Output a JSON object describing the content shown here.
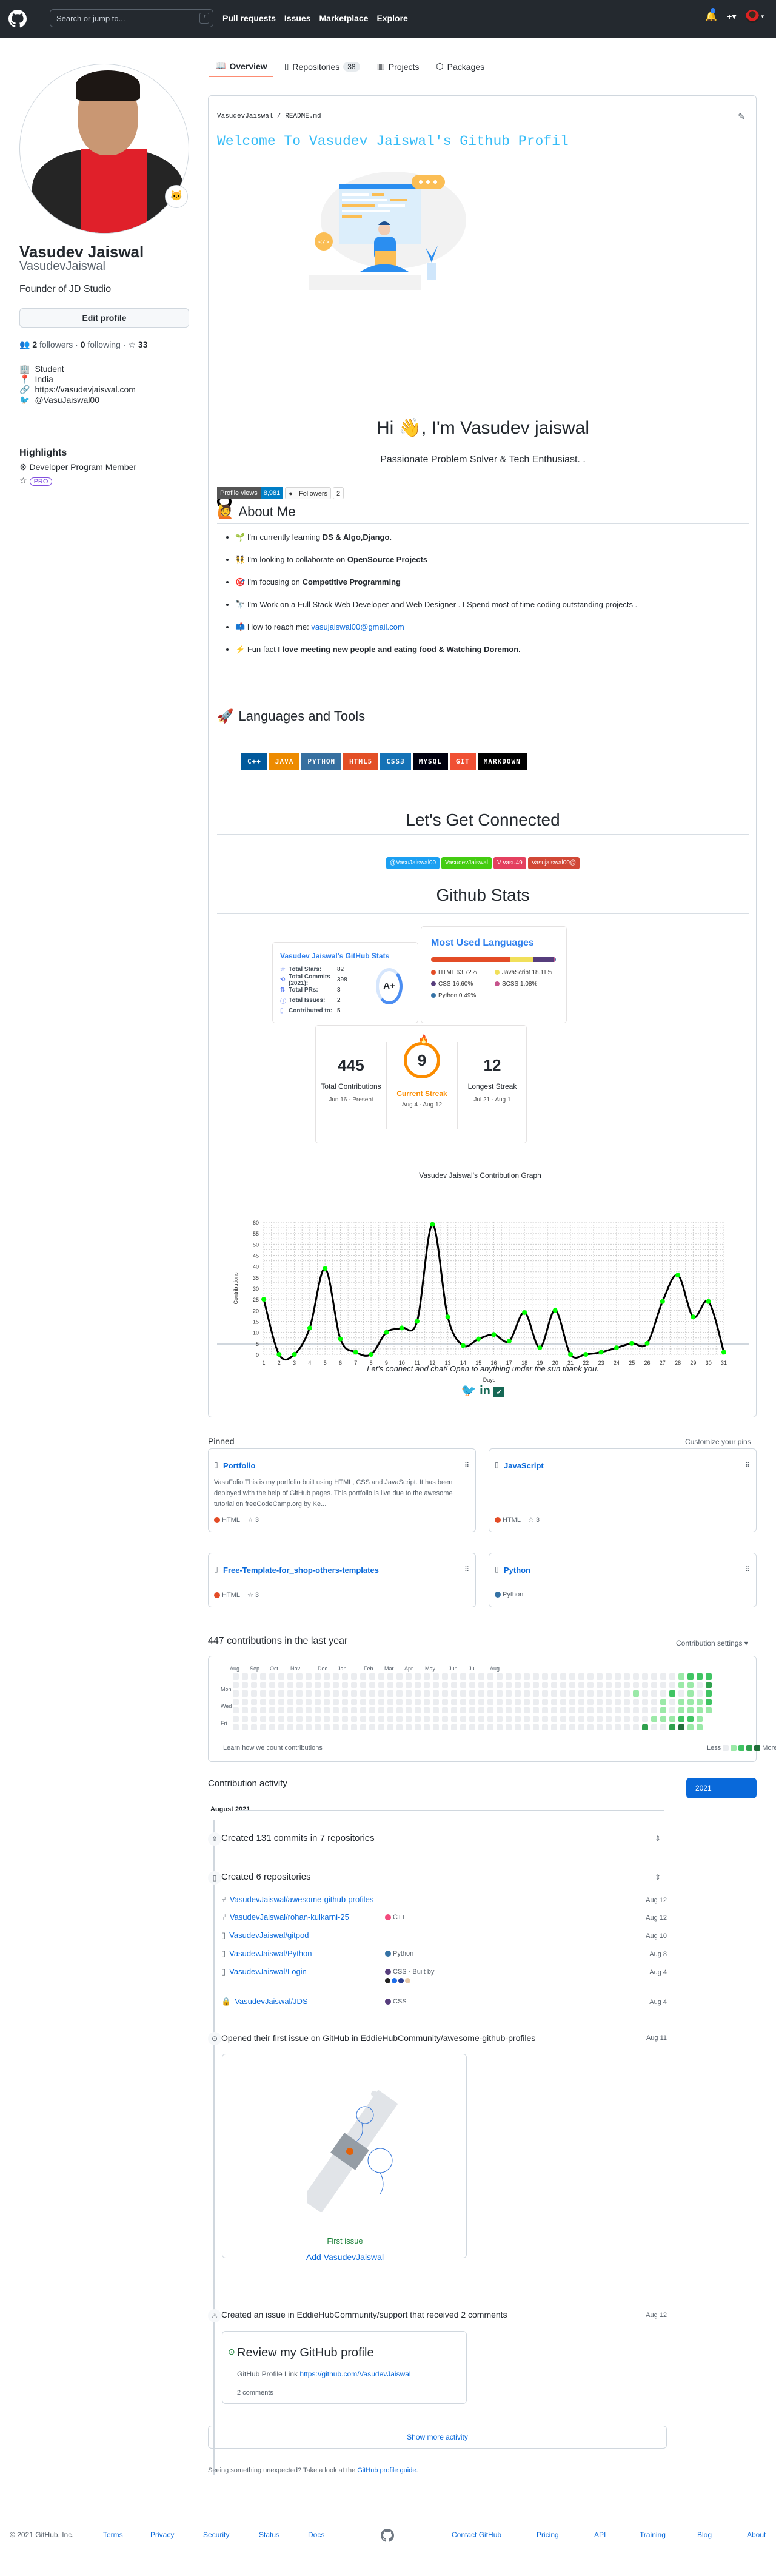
{
  "header": {
    "search_placeholder": "Search or jump to...",
    "search_shortcut": "/",
    "nav": [
      "Pull requests",
      "Issues",
      "Marketplace",
      "Explore"
    ],
    "plus_label": "+▾",
    "avatar_caret": "▾"
  },
  "tabs": [
    {
      "label": "Overview",
      "icon": "book-icon",
      "active": true
    },
    {
      "label": "Repositories",
      "icon": "repo-icon",
      "count": "38"
    },
    {
      "label": "Projects",
      "icon": "project-icon"
    },
    {
      "label": "Packages",
      "icon": "package-icon"
    }
  ],
  "profile": {
    "fullname": "Vasudev Jaiswal",
    "login": "VasudevJaiswal",
    "bio": "Founder of JD Studio",
    "edit_button": "Edit profile",
    "followers": "2",
    "followers_label": "followers",
    "following": "0",
    "following_label": "following",
    "stars": "33",
    "company": "Student",
    "location": "India",
    "website": "https://vasudevjaiswal.com",
    "twitter": "@VasuJaiswal00",
    "highlights_title": "Highlights",
    "highlight_program": "Developer Program Member",
    "pro_badge": "PRO"
  },
  "readme": {
    "path": "VasudevJaiswal / README.md",
    "typing_text": "Welcome To Vasudev Jaiswal's Github Profil",
    "greeting": "Hi 👋, I'm Vasudev jaiswal",
    "tagline": "Passionate Problem Solver & Tech Enthusiast. .",
    "badge_views_label": "Profile views",
    "badge_views_value": "8,981",
    "badge_followers_label": "Followers",
    "badge_followers_value": "2",
    "about_title": "About Me",
    "about_items": [
      {
        "emoji": "🌱",
        "text": "I'm currently learning ",
        "bold": "DS & Algo,Django."
      },
      {
        "emoji": "👯",
        "text": "I'm looking to collaborate on ",
        "bold": "OpenSource Projects"
      },
      {
        "emoji": "🎯",
        "text": "I'm focusing on ",
        "bold": "Competitive Programming"
      },
      {
        "emoji": "🔭",
        "text": "I'm Work on a Full Stack Web Developer and Web Designer . I Spend most of time coding outstanding projects .",
        "bold": ""
      },
      {
        "emoji": "📫",
        "text": "How to reach me: ",
        "link": "vasujaiswal00@gmail.com"
      },
      {
        "emoji": "⚡",
        "text": "Fun fact ",
        "bold": "I love meeting new people and eating food & Watching Doremon."
      }
    ],
    "tools_title": "Languages and Tools",
    "tools": [
      {
        "label": "C++",
        "color": "#00599c"
      },
      {
        "label": "JAVA",
        "color": "#ed8b00"
      },
      {
        "label": "PYTHON",
        "color": "#3670a0"
      },
      {
        "label": "HTML5",
        "color": "#e34f26"
      },
      {
        "label": "CSS3",
        "color": "#1572b6"
      },
      {
        "label": "MYSQL",
        "color": "#00000f"
      },
      {
        "label": "GIT",
        "color": "#f05033"
      },
      {
        "label": "MARKDOWN",
        "color": "#000000"
      }
    ],
    "connect_title": "Let's Get Connected",
    "social": [
      {
        "label": "@VasuJaiswal00",
        "color": "#1ca0f2"
      },
      {
        "label": "VasudevJaiswal",
        "color": "#44cc11"
      },
      {
        "label": "V vasu49",
        "color": "#e4405f"
      },
      {
        "label": "Vasujaiswal00@",
        "color": "#d14836"
      }
    ],
    "stats_title": "Github Stats",
    "stats_card": {
      "title": "Vasudev Jaiswal's GitHub Stats",
      "rows": [
        {
          "icon": "star-icon",
          "label": "Total Stars:",
          "value": "82"
        },
        {
          "icon": "history-icon",
          "label": "Total Commits (2021):",
          "value": "398"
        },
        {
          "icon": "pr-icon",
          "label": "Total PRs:",
          "value": "3"
        },
        {
          "icon": "issue-icon",
          "label": "Total Issues:",
          "value": "2"
        },
        {
          "icon": "repo-icon",
          "label": "Contributed to:",
          "value": "5"
        }
      ],
      "grade": "A+"
    },
    "langs_card": {
      "title": "Most Used Languages",
      "langs": [
        {
          "name": "HTML",
          "pct": 63.72,
          "label": "HTML 63.72%",
          "color": "#e34c26"
        },
        {
          "name": "JavaScript",
          "pct": 18.11,
          "label": "JavaScript 18.11%",
          "color": "#f1e05a"
        },
        {
          "name": "CSS",
          "pct": 16.6,
          "label": "CSS 16.60%",
          "color": "#563d7c"
        },
        {
          "name": "SCSS",
          "pct": 1.08,
          "label": "SCSS 1.08%",
          "color": "#c6538c"
        },
        {
          "name": "Python",
          "pct": 0.49,
          "label": "Python 0.49%",
          "color": "#3572a5"
        }
      ]
    },
    "streak_card": {
      "total": "445",
      "total_label": "Total Contributions",
      "total_range": "Jun 16 - Present",
      "current": "9",
      "current_label": "Current Streak",
      "current_range": "Aug 4 - Aug 12",
      "longest": "12",
      "longest_label": "Longest Streak",
      "longest_range": "Jul 21 - Aug 1"
    },
    "closing_text": "Let's connect and chat! Open to anything under the sun thank you."
  },
  "chart_data": {
    "type": "line",
    "title": "Vasudev Jaiswal's Contribution Graph",
    "xlabel": "Days",
    "ylabel": "Contributions",
    "x": [
      1,
      2,
      3,
      4,
      5,
      6,
      7,
      8,
      9,
      10,
      11,
      12,
      13,
      14,
      15,
      16,
      17,
      18,
      19,
      20,
      21,
      22,
      23,
      24,
      25,
      26,
      27,
      28,
      29,
      30,
      31
    ],
    "values": [
      25,
      0,
      0,
      12,
      39,
      7,
      1,
      0,
      10,
      12,
      15,
      59,
      17,
      4,
      7,
      9,
      6,
      19,
      3,
      20,
      0,
      0,
      1,
      3,
      5,
      5,
      24,
      36,
      17,
      24,
      1
    ],
    "ylim": [
      0,
      60
    ],
    "yticks": [
      0,
      5,
      10,
      15,
      20,
      25,
      30,
      35,
      40,
      45,
      50,
      55,
      60
    ],
    "grid": true,
    "line_color": "#000000",
    "point_color": "#00ff00"
  },
  "pinned": {
    "title": "Pinned",
    "customize": "Customize your pins",
    "items": [
      {
        "name": "Portfolio",
        "desc": "VasuFolio This is my portfolio built using HTML, CSS and JavaScript. It has been deployed with the help of GitHub pages. This portfolio is live due to the awesome tutorial on freeCodeCamp.org by Ke...",
        "lang": "HTML",
        "lang_color": "#e34c26",
        "stars": "3"
      },
      {
        "name": "JavaScript",
        "desc": "",
        "lang": "HTML",
        "lang_color": "#e34c26",
        "stars": "3"
      },
      {
        "name": "Free-Template-for_shop-others-templates",
        "desc": "",
        "lang": "HTML",
        "lang_color": "#e34c26",
        "stars": "3"
      },
      {
        "name": "Python",
        "desc": "",
        "lang": "Python",
        "lang_color": "#3572a5",
        "stars": ""
      }
    ]
  },
  "calendar": {
    "title": "447 contributions in the last year",
    "settings": "Contribution settings ▾",
    "months": [
      "Aug",
      "Sep",
      "Oct",
      "Nov",
      "Dec",
      "Jan",
      "Feb",
      "Mar",
      "Apr",
      "May",
      "Jun",
      "Jul",
      "Aug"
    ],
    "days": [
      "Mon",
      "Wed",
      "Fri"
    ],
    "learn": "Learn how we count contributions",
    "less": "Less",
    "more": "More",
    "levels": [
      "#ebedf0",
      "#9be9a8",
      "#40c463",
      "#30a14e",
      "#216e39"
    ]
  },
  "activity": {
    "title": "Contribution activity",
    "year_button": "2021",
    "month": "August 2021",
    "commits_summary": "Created 131 commits in 7 repositories",
    "repos_summary": "Created 6 repositories",
    "repos": [
      {
        "icon": "fork-icon",
        "name": "VasudevJaiswal/awesome-github-profiles",
        "lang": "",
        "date": "Aug 12"
      },
      {
        "icon": "fork-icon",
        "name": "VasudevJaiswal/rohan-kulkarni-25",
        "lang": "C++",
        "lang_color": "#f34b7d",
        "date": "Aug 12"
      },
      {
        "icon": "repo-icon",
        "name": "VasudevJaiswal/gitpod",
        "lang": "",
        "date": "Aug 10"
      },
      {
        "icon": "repo-icon",
        "name": "VasudevJaiswal/Python",
        "lang": "Python",
        "lang_color": "#3572a5",
        "date": "Aug 8"
      },
      {
        "icon": "repo-icon",
        "name": "VasudevJaiswal/Login",
        "lang": "CSS",
        "lang_color": "#563d7c",
        "built_by": "Built by",
        "date": "Aug 4"
      },
      {
        "icon": "lock-icon",
        "name": "VasudevJaiswal/JDS",
        "lang": "CSS",
        "lang_color": "#563d7c",
        "date": "Aug 4"
      }
    ],
    "first_issue_text": "Opened their first issue on GitHub in EddieHubCommunity/awesome-github-profiles",
    "first_issue_date": "Aug 11",
    "first_issue_label": "First issue",
    "first_issue_link": "Add VasudevJaiswal",
    "issue_text": "Created an issue in EddieHubCommunity/support that received 2 comments",
    "issue_date": "Aug 12",
    "issue_title": "Review my GitHub profile",
    "issue_body_prefix": "GitHub Profile Link ",
    "issue_body_link": "https://github.com/VasudevJaiswal",
    "issue_comments": "2 comments",
    "show_more": "Show more activity",
    "guide_prefix": "Seeing something unexpected? Take a look at the ",
    "guide_link": "GitHub profile guide",
    "guide_suffix": "."
  },
  "footer": {
    "copyright": "© 2021 GitHub, Inc.",
    "left_links": [
      "Terms",
      "Privacy",
      "Security",
      "Status",
      "Docs"
    ],
    "right_links": [
      "Contact GitHub",
      "Pricing",
      "API",
      "Training",
      "Blog",
      "About"
    ]
  }
}
